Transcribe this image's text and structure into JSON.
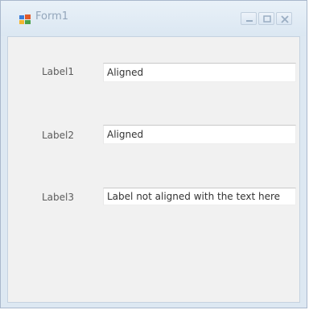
{
  "window": {
    "title": "Form1"
  },
  "rows": [
    {
      "label": "Label1",
      "value": "Aligned"
    },
    {
      "label": "Label2",
      "value": "Aligned"
    },
    {
      "label": "Label3",
      "value": "Label not aligned with the text here"
    }
  ],
  "colors": {
    "window_frame": "#dde8f2",
    "client_bg": "#f1f1f1",
    "text": "#5c5c5c"
  }
}
